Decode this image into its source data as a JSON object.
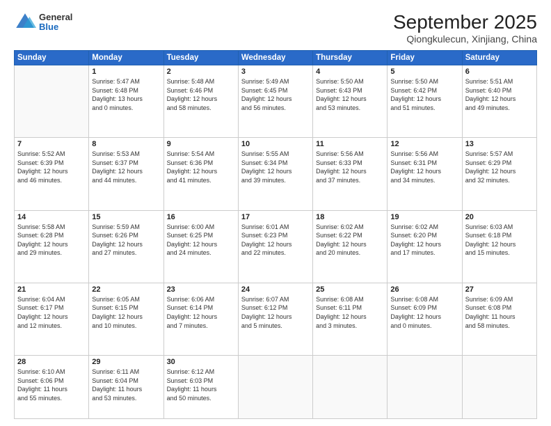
{
  "header": {
    "logo": {
      "general": "General",
      "blue": "Blue"
    },
    "title": "September 2025",
    "location": "Qiongkulecun, Xinjiang, China"
  },
  "weekdays": [
    "Sunday",
    "Monday",
    "Tuesday",
    "Wednesday",
    "Thursday",
    "Friday",
    "Saturday"
  ],
  "weeks": [
    [
      {
        "day": null
      },
      {
        "day": 1,
        "sunrise": "5:47 AM",
        "sunset": "6:48 PM",
        "daylight": "13 hours and 0 minutes."
      },
      {
        "day": 2,
        "sunrise": "5:48 AM",
        "sunset": "6:46 PM",
        "daylight": "12 hours and 58 minutes."
      },
      {
        "day": 3,
        "sunrise": "5:49 AM",
        "sunset": "6:45 PM",
        "daylight": "12 hours and 56 minutes."
      },
      {
        "day": 4,
        "sunrise": "5:50 AM",
        "sunset": "6:43 PM",
        "daylight": "12 hours and 53 minutes."
      },
      {
        "day": 5,
        "sunrise": "5:50 AM",
        "sunset": "6:42 PM",
        "daylight": "12 hours and 51 minutes."
      },
      {
        "day": 6,
        "sunrise": "5:51 AM",
        "sunset": "6:40 PM",
        "daylight": "12 hours and 49 minutes."
      }
    ],
    [
      {
        "day": 7,
        "sunrise": "5:52 AM",
        "sunset": "6:39 PM",
        "daylight": "12 hours and 46 minutes."
      },
      {
        "day": 8,
        "sunrise": "5:53 AM",
        "sunset": "6:37 PM",
        "daylight": "12 hours and 44 minutes."
      },
      {
        "day": 9,
        "sunrise": "5:54 AM",
        "sunset": "6:36 PM",
        "daylight": "12 hours and 41 minutes."
      },
      {
        "day": 10,
        "sunrise": "5:55 AM",
        "sunset": "6:34 PM",
        "daylight": "12 hours and 39 minutes."
      },
      {
        "day": 11,
        "sunrise": "5:56 AM",
        "sunset": "6:33 PM",
        "daylight": "12 hours and 37 minutes."
      },
      {
        "day": 12,
        "sunrise": "5:56 AM",
        "sunset": "6:31 PM",
        "daylight": "12 hours and 34 minutes."
      },
      {
        "day": 13,
        "sunrise": "5:57 AM",
        "sunset": "6:29 PM",
        "daylight": "12 hours and 32 minutes."
      }
    ],
    [
      {
        "day": 14,
        "sunrise": "5:58 AM",
        "sunset": "6:28 PM",
        "daylight": "12 hours and 29 minutes."
      },
      {
        "day": 15,
        "sunrise": "5:59 AM",
        "sunset": "6:26 PM",
        "daylight": "12 hours and 27 minutes."
      },
      {
        "day": 16,
        "sunrise": "6:00 AM",
        "sunset": "6:25 PM",
        "daylight": "12 hours and 24 minutes."
      },
      {
        "day": 17,
        "sunrise": "6:01 AM",
        "sunset": "6:23 PM",
        "daylight": "12 hours and 22 minutes."
      },
      {
        "day": 18,
        "sunrise": "6:02 AM",
        "sunset": "6:22 PM",
        "daylight": "12 hours and 20 minutes."
      },
      {
        "day": 19,
        "sunrise": "6:02 AM",
        "sunset": "6:20 PM",
        "daylight": "12 hours and 17 minutes."
      },
      {
        "day": 20,
        "sunrise": "6:03 AM",
        "sunset": "6:18 PM",
        "daylight": "12 hours and 15 minutes."
      }
    ],
    [
      {
        "day": 21,
        "sunrise": "6:04 AM",
        "sunset": "6:17 PM",
        "daylight": "12 hours and 12 minutes."
      },
      {
        "day": 22,
        "sunrise": "6:05 AM",
        "sunset": "6:15 PM",
        "daylight": "12 hours and 10 minutes."
      },
      {
        "day": 23,
        "sunrise": "6:06 AM",
        "sunset": "6:14 PM",
        "daylight": "12 hours and 7 minutes."
      },
      {
        "day": 24,
        "sunrise": "6:07 AM",
        "sunset": "6:12 PM",
        "daylight": "12 hours and 5 minutes."
      },
      {
        "day": 25,
        "sunrise": "6:08 AM",
        "sunset": "6:11 PM",
        "daylight": "12 hours and 3 minutes."
      },
      {
        "day": 26,
        "sunrise": "6:08 AM",
        "sunset": "6:09 PM",
        "daylight": "12 hours and 0 minutes."
      },
      {
        "day": 27,
        "sunrise": "6:09 AM",
        "sunset": "6:08 PM",
        "daylight": "11 hours and 58 minutes."
      }
    ],
    [
      {
        "day": 28,
        "sunrise": "6:10 AM",
        "sunset": "6:06 PM",
        "daylight": "11 hours and 55 minutes."
      },
      {
        "day": 29,
        "sunrise": "6:11 AM",
        "sunset": "6:04 PM",
        "daylight": "11 hours and 53 minutes."
      },
      {
        "day": 30,
        "sunrise": "6:12 AM",
        "sunset": "6:03 PM",
        "daylight": "11 hours and 50 minutes."
      },
      {
        "day": null
      },
      {
        "day": null
      },
      {
        "day": null
      },
      {
        "day": null
      }
    ]
  ]
}
